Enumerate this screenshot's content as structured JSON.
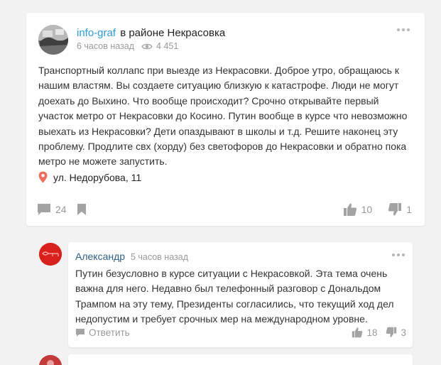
{
  "post": {
    "author": "info-graf",
    "location": "в районе Некрасовка",
    "time": "6 часов назад",
    "views": "4 451",
    "text": "Транспортный коллапс при выезде из Некрасовки. Доброе утро, обращаюсь к нашим властям. Вы создаете ситуацию близкую к катастрофе. Люди не могут доехать до Выхино. Что вообще происходит? Срочно открывайте первый участок метро от Некрасовки до Косино. Путин вообще в курсе что невозможно выехать из Некрасовки? Дети опаздывают в школы и т.д. Решите наконец эту проблему. Продлите свх (хорду) без светофоров до Некрасовки и обратно пока метро не можете запустить.",
    "address": "ул. Недорубова, 11",
    "comments_count": "24",
    "likes": "10",
    "dislikes": "1"
  },
  "comment": {
    "author": "Александр",
    "time": "5 часов назад",
    "text": "Путин безусловно в курсе ситуации с Некрасовкой. Эта тема очень важна для него. Недавно был телефонный разговор с Дональдом Трампом на эту тему, Президенты согласились, что текущий ход дел недопустим и требует срочных мер на международном уровне.",
    "reply_label": "Ответить",
    "likes": "18",
    "dislikes": "3"
  },
  "colors": {
    "author_link": "#2b9ad6",
    "comment_author": "#2f5f86",
    "icon_gray": "#a3a3a3",
    "pin_red": "#f06c5b"
  },
  "icons": [
    "eye-icon",
    "map-pin-icon",
    "comment-icon",
    "bookmark-icon",
    "thumbs-up-icon",
    "thumbs-down-icon",
    "more-dots-icon"
  ]
}
